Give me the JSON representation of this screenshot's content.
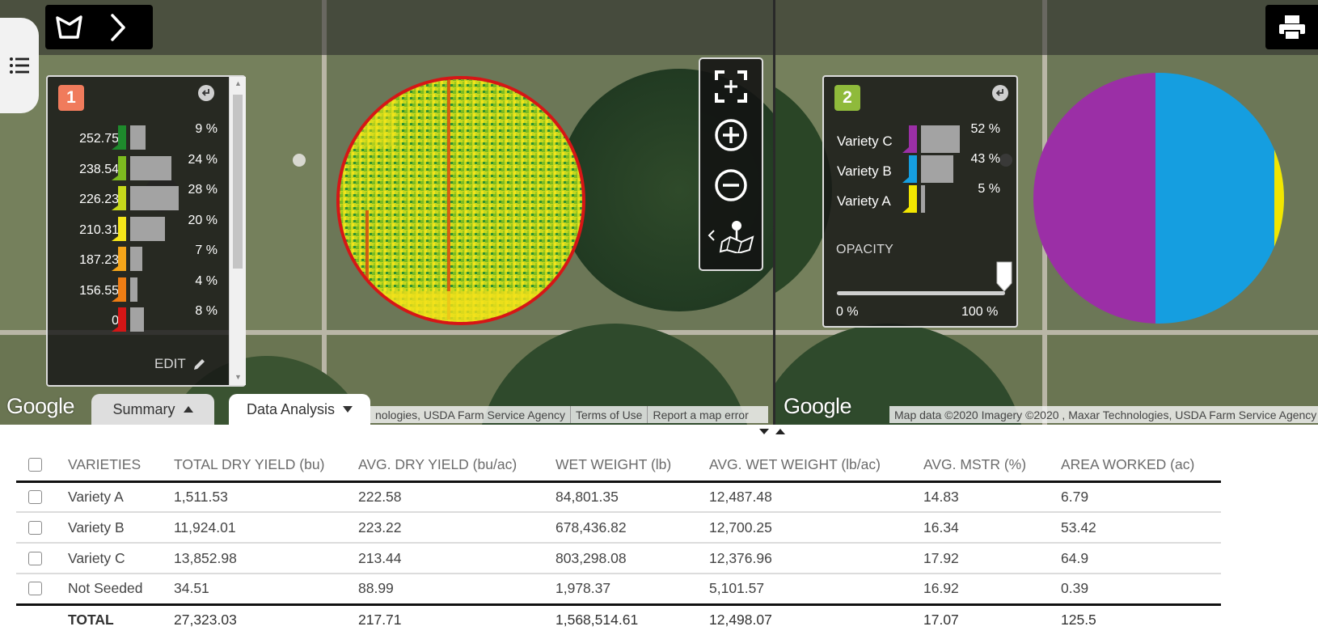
{
  "toolbar": {
    "boundary_icon": "boundary-polygon-icon",
    "next_icon": "chevron-right-icon"
  },
  "side_tab": {
    "icon": "list-icon"
  },
  "print": {
    "icon": "printer-icon"
  },
  "legend1": {
    "badge": "1",
    "badge_color": "#f07b5c",
    "rows": [
      {
        "value": "252.75",
        "percent": "9 %",
        "color": "#1e8a2c",
        "share": 0.09
      },
      {
        "value": "238.54",
        "percent": "24 %",
        "color": "#7dbb1f",
        "share": 0.24
      },
      {
        "value": "226.23",
        "percent": "28 %",
        "color": "#c6d91b",
        "share": 0.28
      },
      {
        "value": "210.31",
        "percent": "20 %",
        "color": "#f4e51a",
        "share": 0.2
      },
      {
        "value": "187.23",
        "percent": "7 %",
        "color": "#f4a51a",
        "share": 0.07
      },
      {
        "value": "156.55",
        "percent": "4 %",
        "color": "#ee7d14",
        "share": 0.04
      },
      {
        "value": "0",
        "percent": "8 %",
        "color": "#d41616",
        "share": 0.08
      }
    ],
    "edit_label": "EDIT"
  },
  "legend2": {
    "badge": "2",
    "badge_color": "#8fba3b",
    "rows": [
      {
        "label": "Variety C",
        "percent": "52 %",
        "color": "#9b2fa6",
        "share": 0.52
      },
      {
        "label": "Variety B",
        "percent": "43 %",
        "color": "#159ee0",
        "share": 0.43
      },
      {
        "label": "Variety A",
        "percent": "5 %",
        "color": "#f2e600",
        "share": 0.05
      }
    ],
    "opacity_label": "OPACITY",
    "opacity_min": "0 %",
    "opacity_max": "100 %",
    "opacity_value": 1.0
  },
  "map": {
    "google_logo": "Google",
    "attribution_left": "nologies, USDA Farm Service Agency",
    "terms": "Terms of Use",
    "report": "Report a map error",
    "attribution_right": "Map data ©2020 Imagery ©2020 , Maxar Technologies, USDA Farm Service Agency"
  },
  "tabs": {
    "summary": "Summary",
    "analysis": "Data Analysis"
  },
  "table": {
    "headers": [
      "VARIETIES",
      "TOTAL DRY YIELD (bu)",
      "AVG. DRY YIELD (bu/ac)",
      "WET WEIGHT (lb)",
      "AVG. WET WEIGHT (lb/ac)",
      "AVG. MSTR (%)",
      "AREA WORKED (ac)"
    ],
    "rows": [
      [
        "Variety A",
        "1,511.53",
        "222.58",
        "84,801.35",
        "12,487.48",
        "14.83",
        "6.79"
      ],
      [
        "Variety B",
        "11,924.01",
        "223.22",
        "678,436.82",
        "12,700.25",
        "16.34",
        "53.42"
      ],
      [
        "Variety C",
        "13,852.98",
        "213.44",
        "803,298.08",
        "12,376.96",
        "17.92",
        "64.9"
      ],
      [
        "Not Seeded",
        "34.51",
        "88.99",
        "1,978.37",
        "5,101.57",
        "16.92",
        "0.39"
      ]
    ],
    "total": [
      "TOTAL",
      "27,323.03",
      "217.71",
      "1,568,514.61",
      "12,498.07",
      "17.07",
      "125.5"
    ]
  }
}
